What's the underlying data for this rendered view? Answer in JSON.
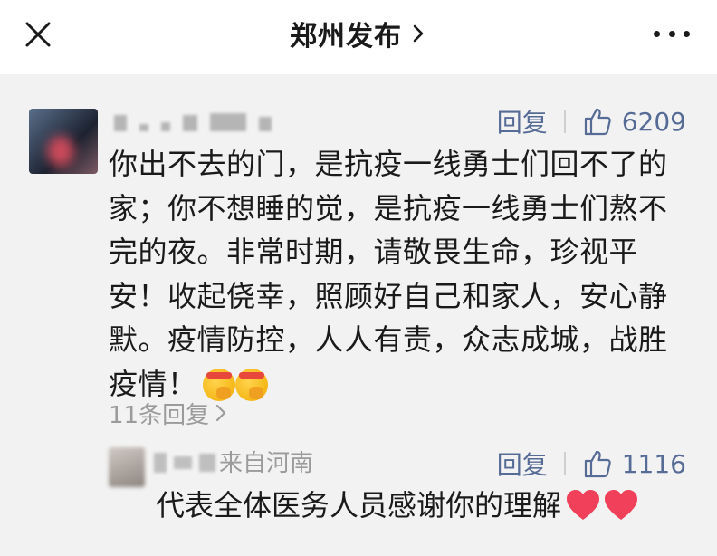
{
  "header": {
    "title": "郑州发布"
  },
  "comment": {
    "reply_label": "回复",
    "like_count": "6209",
    "text": "你出不去的门，是抗疫一线勇士们回不了的家；你不想睡的觉，是抗疫一线勇士们熬不完的夜。非常时期，请敬畏生命，珍视平安！收起侥幸，照顾好自己和家人，安心静默。疫情防控，人人有责，众志成城，战胜疫情！",
    "emojis": [
      "determined-face-icon",
      "determined-face-icon"
    ],
    "replies_link": "11条回复"
  },
  "reply": {
    "location": "来自河南",
    "reply_label": "回复",
    "like_count": "1116",
    "text": "代表全体医务人员感谢你的理解",
    "emojis": [
      "heart-icon",
      "heart-icon"
    ]
  },
  "colors": {
    "accent": "#566b95",
    "muted": "#9b9b9b",
    "panel_bg": "#f2f2f2",
    "heart": "#f0405a"
  }
}
